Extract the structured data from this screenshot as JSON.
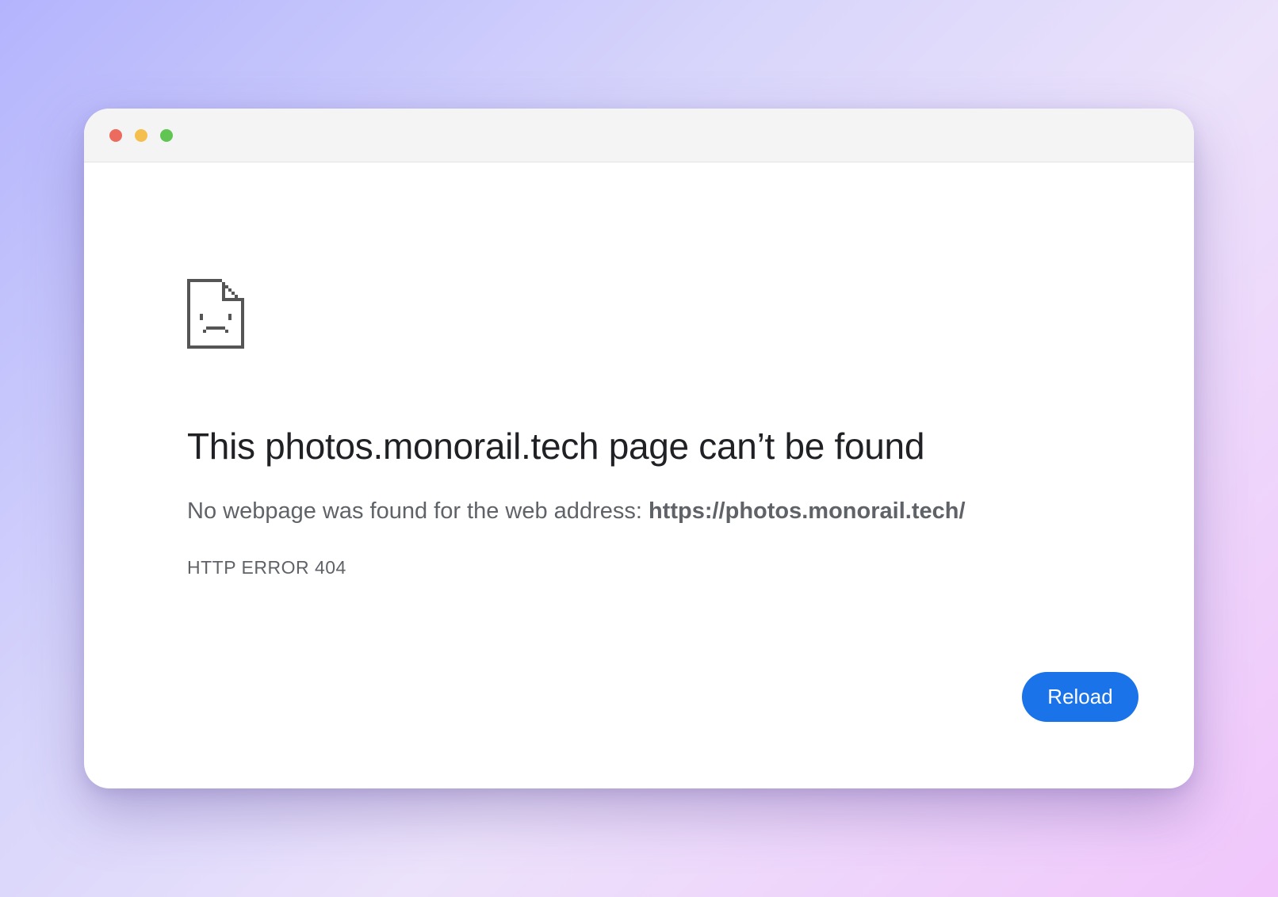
{
  "window": {
    "controls": [
      "close",
      "minimize",
      "maximize"
    ]
  },
  "error_page": {
    "icon": "sad-page-icon",
    "headline": "This photos.monorail.tech page can’t be found",
    "message_prefix": "No webpage was found for the web address: ",
    "url": "https://photos.monorail.tech/",
    "error_code": "HTTP ERROR 404",
    "reload_label": "Reload"
  },
  "colors": {
    "accent": "#1a73e8",
    "close": "#ec6a5e",
    "minimize": "#f4bf4f",
    "maximize": "#61c554"
  }
}
